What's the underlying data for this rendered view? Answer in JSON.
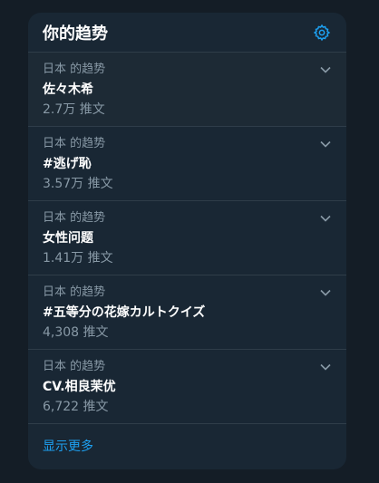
{
  "header": {
    "title": "你的趋势"
  },
  "trends": [
    {
      "context": "日本 的趋势",
      "name": "佐々木希",
      "count": "2.7万 推文"
    },
    {
      "context": "日本 的趋势",
      "name": "#逃げ恥",
      "count": "3.57万 推文"
    },
    {
      "context": "日本 的趋势",
      "name": "女性问题",
      "count": "1.41万 推文"
    },
    {
      "context": "日本 的趋势",
      "name": "#五等分の花嫁カルトクイズ",
      "count": "4,308 推文"
    },
    {
      "context": "日本 的趋势",
      "name": "CV.相良茉优",
      "count": "6,722 推文"
    }
  ],
  "footer": {
    "show_more": "显示更多"
  },
  "colors": {
    "background": "#141d26",
    "card": "#192734",
    "accent": "#1da1f2",
    "muted_text": "#8899a6",
    "divider": "#2f3d49"
  },
  "icons": {
    "settings": "gear-icon",
    "more": "chevron-down-icon"
  }
}
